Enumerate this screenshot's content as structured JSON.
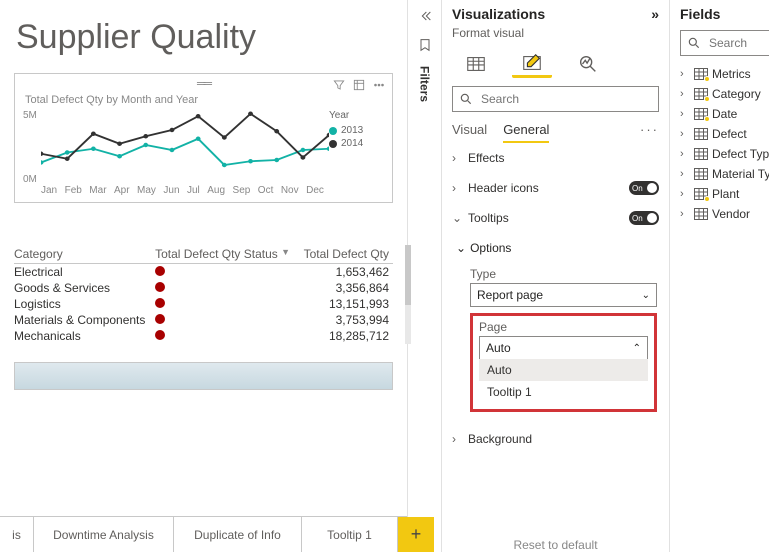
{
  "canvas": {
    "title": "Supplier Quality",
    "chart_card": {
      "title": "Total Defect Qty by Month and Year",
      "legend_title": "Year"
    },
    "tabs": {
      "cut": "is",
      "downtime": "Downtime Analysis",
      "duplicate": "Duplicate of Info",
      "tooltip1": "Tooltip 1",
      "add": "+"
    }
  },
  "chart_data": {
    "type": "line",
    "title": "Total Defect Qty by Month and Year",
    "xlabel": "",
    "ylabel": "",
    "categories": [
      "Jan",
      "Feb",
      "Mar",
      "Apr",
      "May",
      "Jun",
      "Jul",
      "Aug",
      "Sep",
      "Oct",
      "Nov",
      "Dec"
    ],
    "ylim": [
      0,
      6000000
    ],
    "y_ticks": [
      "5M",
      "0M"
    ],
    "series": [
      {
        "name": "2013",
        "color": "#12b2a6",
        "values": [
          1800000,
          2600000,
          2900000,
          2300000,
          3200000,
          2800000,
          3700000,
          1600000,
          1900000,
          2000000,
          2800000,
          2900000
        ]
      },
      {
        "name": "2014",
        "color": "#323232",
        "values": [
          2500000,
          2100000,
          4100000,
          3300000,
          3900000,
          4400000,
          5500000,
          3800000,
          5700000,
          4300000,
          2200000,
          4000000
        ]
      }
    ]
  },
  "table": {
    "col1": "Category",
    "col2": "Total Defect Qty Status",
    "col3": "Total Defect Qty",
    "rows": [
      {
        "cat": "Electrical",
        "qty": "1,653,462"
      },
      {
        "cat": "Goods & Services",
        "qty": "3,356,864"
      },
      {
        "cat": "Logistics",
        "qty": "13,151,993"
      },
      {
        "cat": "Materials & Components",
        "qty": "3,753,994"
      },
      {
        "cat": "Mechanicals",
        "qty": "18,285,712"
      }
    ]
  },
  "filters": {
    "label": "Filters"
  },
  "viz": {
    "title": "Visualizations",
    "sub": "Format visual",
    "search_placeholder": "Search",
    "tab_visual": "Visual",
    "tab_general": "General",
    "sect_effects": "Effects",
    "sect_header": "Header icons",
    "sect_tooltips": "Tooltips",
    "on": "On",
    "options": "Options",
    "type_label": "Type",
    "type_value": "Report page",
    "page_label": "Page",
    "page_value": "Auto",
    "dd_auto": "Auto",
    "dd_t1": "Tooltip 1",
    "sect_bg": "Background",
    "reset": "Reset to default"
  },
  "fields": {
    "title": "Fields",
    "search_placeholder": "Search",
    "items": [
      {
        "name": "Metrics",
        "measure": true
      },
      {
        "name": "Category",
        "measure": true
      },
      {
        "name": "Date",
        "measure": true
      },
      {
        "name": "Defect",
        "measure": false
      },
      {
        "name": "Defect Type",
        "measure": false
      },
      {
        "name": "Material Type",
        "measure": false
      },
      {
        "name": "Plant",
        "measure": true
      },
      {
        "name": "Vendor",
        "measure": false
      }
    ]
  }
}
